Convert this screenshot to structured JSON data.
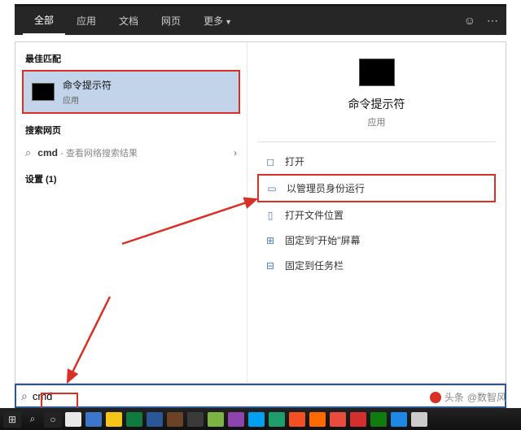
{
  "tabs": {
    "all": "全部",
    "apps": "应用",
    "docs": "文档",
    "web": "网页",
    "more": "更多"
  },
  "sections": {
    "best_match": "最佳匹配",
    "search_web": "搜索网页",
    "settings": "设置 (1)"
  },
  "best_match": {
    "title": "命令提示符",
    "subtitle": "应用"
  },
  "web_search": {
    "query": "cmd",
    "hint": "- 查看网络搜索结果"
  },
  "right": {
    "title": "命令提示符",
    "subtitle": "应用"
  },
  "actions": {
    "open": "打开",
    "run_admin": "以管理员身份运行",
    "open_location": "打开文件位置",
    "pin_start": "固定到\"开始\"屏幕",
    "pin_taskbar": "固定到任务栏"
  },
  "search_input": {
    "value": "cmd"
  },
  "attribution": {
    "prefix": "头条",
    "author": "@数智风"
  },
  "taskbar_colors": [
    "#e8e8e8",
    "#3b78cc",
    "#f5c518",
    "#0f7b3e",
    "#2b5797",
    "#6b4226",
    "#3a3a3a",
    "#7cb342",
    "#8e44ad",
    "#00a1f1",
    "#1e9e6a",
    "#f25022",
    "#ff6a00",
    "#e74c3c",
    "#d32f2f",
    "#107c10",
    "#1e88e5",
    "#cccccc"
  ]
}
